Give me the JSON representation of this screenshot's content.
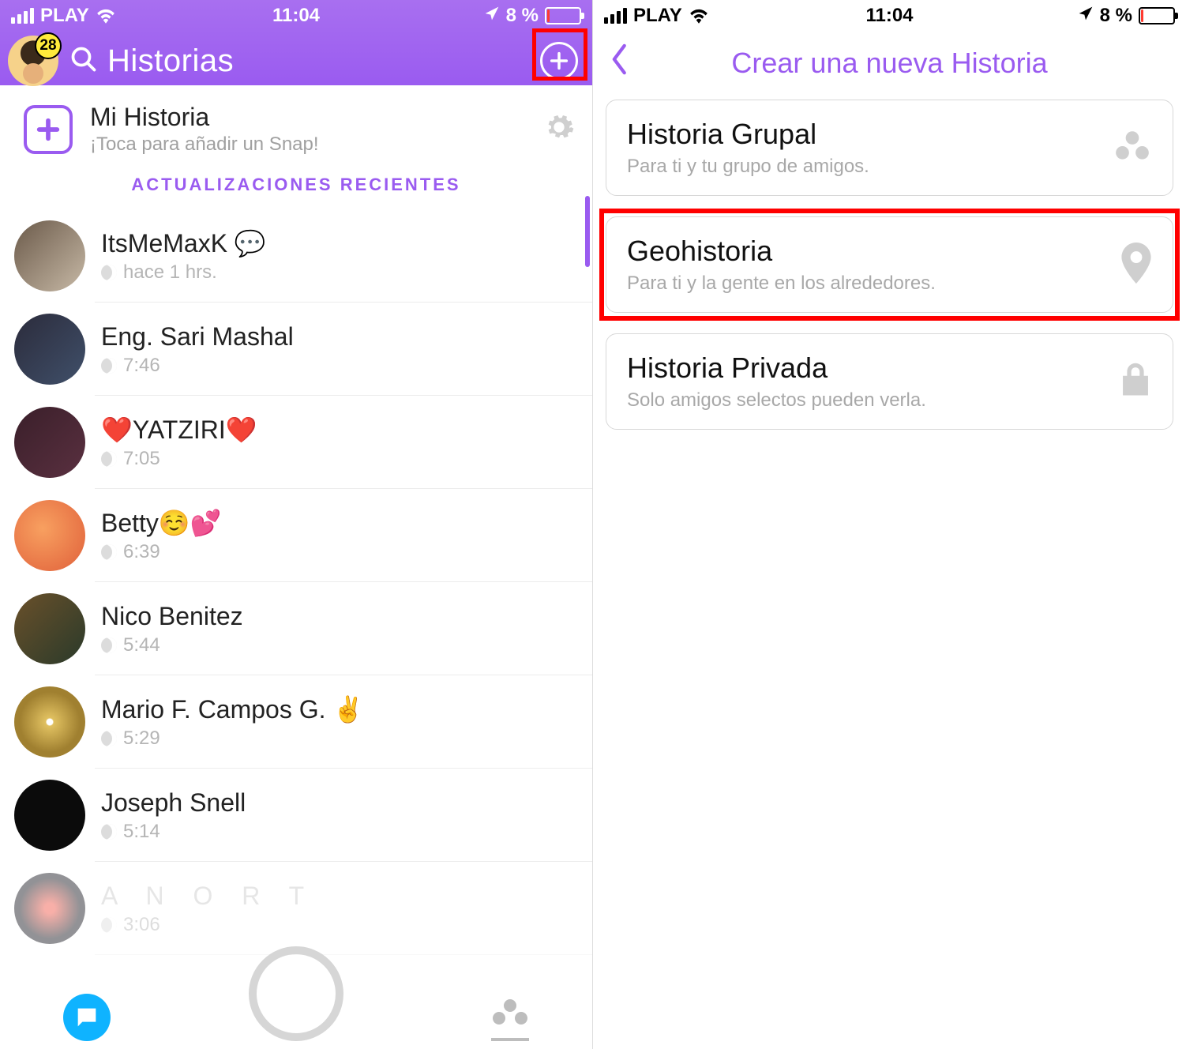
{
  "status": {
    "carrier": "PLAY",
    "time": "11:04",
    "battery_pct": "8 %"
  },
  "left": {
    "header_title": "Historias",
    "badge_count": "28",
    "my_story_title": "Mi Historia",
    "my_story_sub": "¡Toca para añadir un Snap!",
    "section_header": "ACTUALIZACIONES RECIENTES",
    "stories": [
      {
        "name": "ItsMeMaxK 💬",
        "time": "hace 1 hrs."
      },
      {
        "name": "Eng. Sari Mashal",
        "time": "7:46"
      },
      {
        "name": "❤️YATZIRI❤️",
        "time": "7:05"
      },
      {
        "name": "Betty☺️💕",
        "time": "6:39"
      },
      {
        "name": "Nico Benitez",
        "time": "5:44"
      },
      {
        "name": "Mario F. Campos G. ✌️",
        "time": "5:29"
      },
      {
        "name": "Joseph Snell",
        "time": "5:14"
      },
      {
        "name": "A N O R T",
        "time": "3:06"
      }
    ]
  },
  "right": {
    "title": "Crear una nueva Historia",
    "options": [
      {
        "title": "Historia Grupal",
        "sub": "Para ti y tu grupo de amigos.",
        "icon": "group"
      },
      {
        "title": "Geohistoria",
        "sub": "Para ti y la gente en los alrededores.",
        "icon": "pin"
      },
      {
        "title": "Historia Privada",
        "sub": "Solo amigos selectos pueden verla.",
        "icon": "lock"
      }
    ]
  }
}
